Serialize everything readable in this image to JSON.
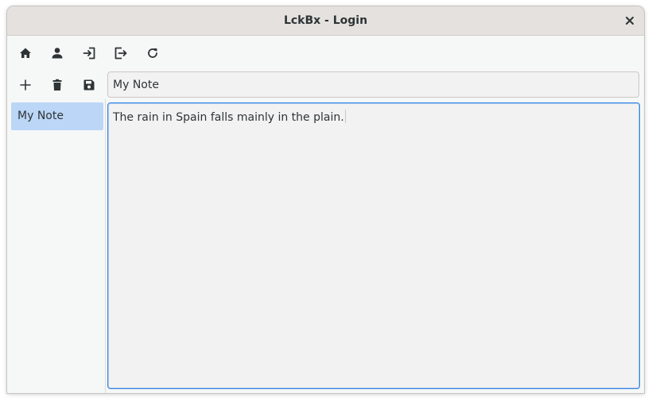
{
  "window": {
    "title": "LckBx - Login",
    "close_icon": "close-icon"
  },
  "toolbar": {
    "buttons": [
      {
        "name": "home",
        "icon": "home-icon"
      },
      {
        "name": "account",
        "icon": "person-icon"
      },
      {
        "name": "login",
        "icon": "login-icon"
      },
      {
        "name": "logout",
        "icon": "logout-icon"
      },
      {
        "name": "refresh",
        "icon": "refresh-icon"
      }
    ]
  },
  "note_toolbar": {
    "buttons": [
      {
        "name": "add",
        "icon": "plus-icon"
      },
      {
        "name": "delete",
        "icon": "trash-icon"
      },
      {
        "name": "save",
        "icon": "save-icon"
      }
    ]
  },
  "note_name": {
    "value": "My Note"
  },
  "sidebar": {
    "items": [
      {
        "label": "My Note",
        "selected": true
      }
    ]
  },
  "editor": {
    "content": "The rain in Spain falls mainly in the plain."
  },
  "colors": {
    "selection": "#bbd6f6",
    "focus_border": "#3584e4",
    "icon": "#2e3436"
  }
}
